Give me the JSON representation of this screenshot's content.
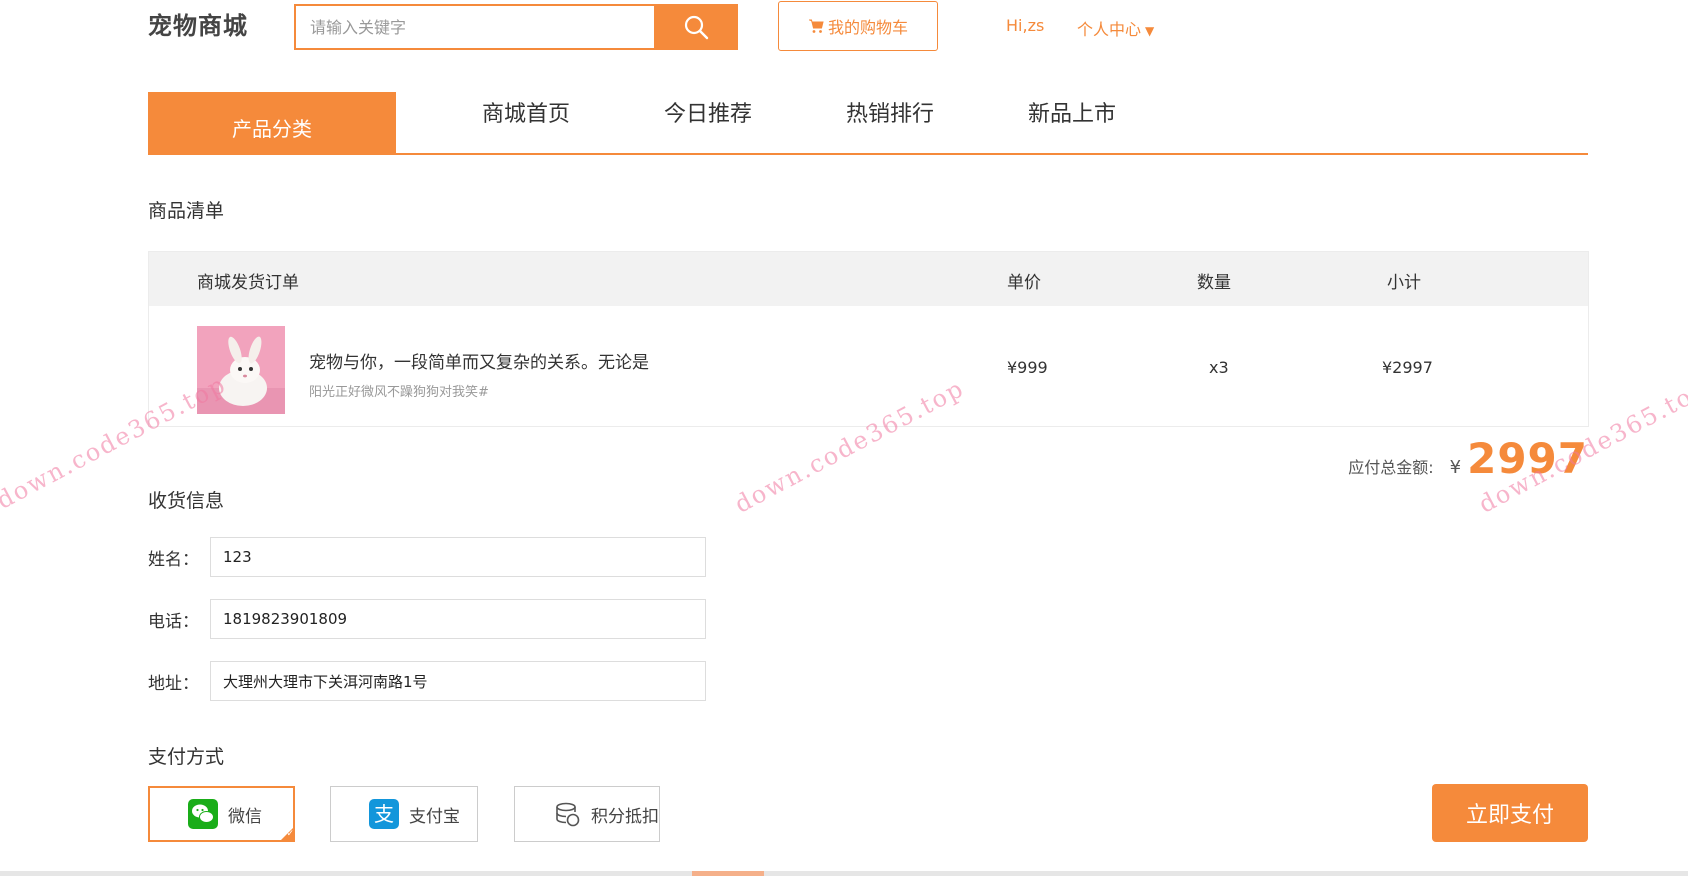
{
  "header": {
    "logo": "宠物商城",
    "search_placeholder": "请输入关键字",
    "cart_label": "我的购物车",
    "greeting": "Hi,zs",
    "user_center": "个人中心"
  },
  "nav": {
    "category": "产品分类",
    "items": [
      "商城首页",
      "今日推荐",
      "热销排行",
      "新品上市"
    ]
  },
  "order": {
    "section_title": "商品清单",
    "columns": [
      "商城发货订单",
      "单价",
      "数量",
      "小计"
    ],
    "item": {
      "title": "宠物与你，一段简单而又复杂的关系。无论是",
      "subtitle": "阳光正好微风不躁狗狗对我笑#",
      "price": "¥999",
      "qty": "x3",
      "subtotal": "¥2997"
    },
    "total_label": "应付总金额:",
    "currency": "¥",
    "total_amount": "2997"
  },
  "shipping": {
    "section_title": "收货信息",
    "name_label": "姓名：",
    "name_value": "123",
    "phone_label": "电话：",
    "phone_value": "1819823901809",
    "address_label": "地址：",
    "address_value": "大理州大理市下关洱河南路1号"
  },
  "payment": {
    "section_title": "支付方式",
    "options": [
      "微信",
      "支付宝",
      "积分抵扣"
    ],
    "pay_button": "立即支付"
  },
  "watermark": "down.code365.top",
  "colors": {
    "accent": "#f58a3b",
    "wechat": "#1aad19",
    "alipay": "#1296db"
  }
}
